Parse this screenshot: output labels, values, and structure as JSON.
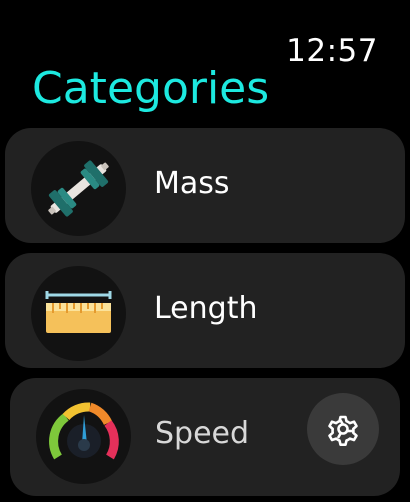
{
  "status": {
    "time": "12:57"
  },
  "header": {
    "title": "Categories"
  },
  "colors": {
    "title": "#1de9e0",
    "row_background": "#222222",
    "icon_background": "#121212",
    "gear_background": "#3a3a3a"
  },
  "categories": [
    {
      "label": "Mass",
      "icon": "dumbbell-icon"
    },
    {
      "label": "Length",
      "icon": "ruler-icon"
    },
    {
      "label": "Speed",
      "icon": "speedometer-icon"
    }
  ],
  "settings_button": {
    "icon": "gear-icon"
  }
}
